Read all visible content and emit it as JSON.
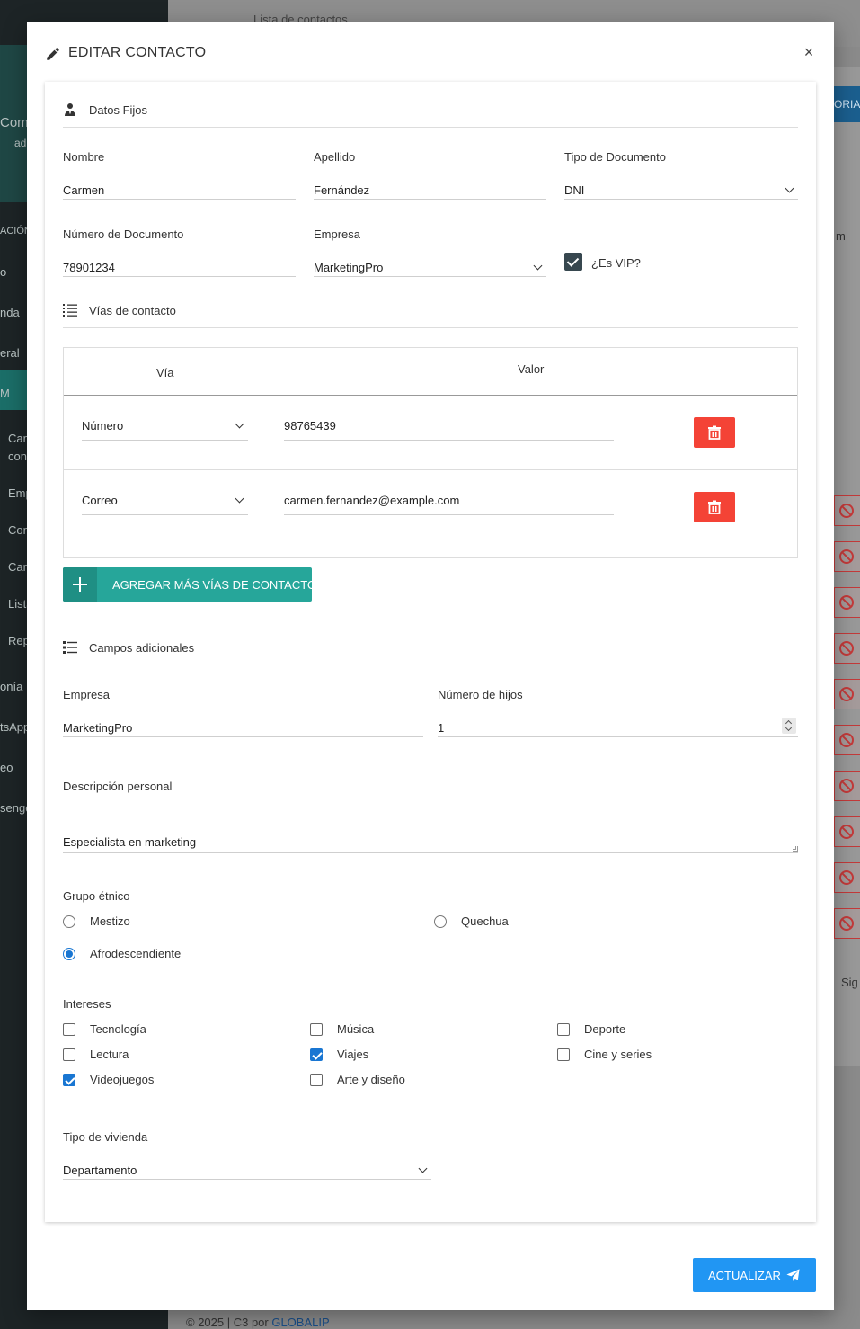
{
  "background": {
    "sidebar_items": [
      "Com",
      "ad",
      "ACIÓN",
      "o",
      "nda",
      "eral",
      "M",
      "Can",
      "con",
      "Emp",
      "Con",
      "Cart",
      "Lista",
      "Rep",
      "onía",
      "tsApp",
      "eo",
      "senge"
    ],
    "header_title": "Lista de contactos",
    "right_button": "ORIA",
    "right_text_1": "m",
    "right_text_2": "Sig",
    "footer_prefix": "© 2025 | C3 por ",
    "footer_link": "GLOBALIP"
  },
  "modal": {
    "title": "EDITAR CONTACTO",
    "close_label": "×",
    "fixed_data": {
      "section_title": "Datos Fijos",
      "nombre": {
        "label": "Nombre",
        "value": "Carmen"
      },
      "apellido": {
        "label": "Apellido",
        "value": "Fernández"
      },
      "tipo_documento": {
        "label": "Tipo de Documento",
        "value": "DNI"
      },
      "numero_documento": {
        "label": "Número de Documento",
        "value": "78901234"
      },
      "empresa": {
        "label": "Empresa",
        "value": "MarketingPro"
      },
      "vip": {
        "label": "¿Es VIP?",
        "checked": true
      }
    },
    "contact_ways": {
      "section_title": "Vías de contacto",
      "col_via": "Vía",
      "col_valor": "Valor",
      "rows": [
        {
          "via": "Número",
          "valor": "98765439"
        },
        {
          "via": "Correo",
          "valor": "carmen.fernandez@example.com"
        }
      ],
      "add_button": "AGREGAR MÁS VÍAS DE CONTACTO"
    },
    "additional": {
      "section_title": "Campos adicionales",
      "empresa": {
        "label": "Empresa",
        "value": "MarketingPro"
      },
      "hijos": {
        "label": "Número de hijos",
        "value": "1"
      },
      "descripcion": {
        "label": "Descripción personal",
        "value": "Especialista en marketing"
      },
      "grupo_etnico": {
        "label": "Grupo étnico",
        "options": [
          {
            "label": "Mestizo",
            "selected": false
          },
          {
            "label": "Quechua",
            "selected": false
          },
          {
            "label": "Afrodescendiente",
            "selected": true
          }
        ]
      },
      "intereses": {
        "label": "Intereses",
        "options": [
          {
            "label": "Tecnología",
            "checked": false
          },
          {
            "label": "Música",
            "checked": false
          },
          {
            "label": "Deporte",
            "checked": false
          },
          {
            "label": "Lectura",
            "checked": false
          },
          {
            "label": "Viajes",
            "checked": true
          },
          {
            "label": "Cine y series",
            "checked": false
          },
          {
            "label": "Videojuegos",
            "checked": true
          },
          {
            "label": "Arte y diseño",
            "checked": false
          }
        ]
      },
      "vivienda": {
        "label": "Tipo de vivienda",
        "value": "Departamento"
      }
    },
    "update_button": "ACTUALIZAR"
  },
  "colors": {
    "accent_teal": "#26a69a",
    "delete_red": "#f44336",
    "primary_blue": "#2196f3",
    "check_blue": "#1976d2"
  }
}
